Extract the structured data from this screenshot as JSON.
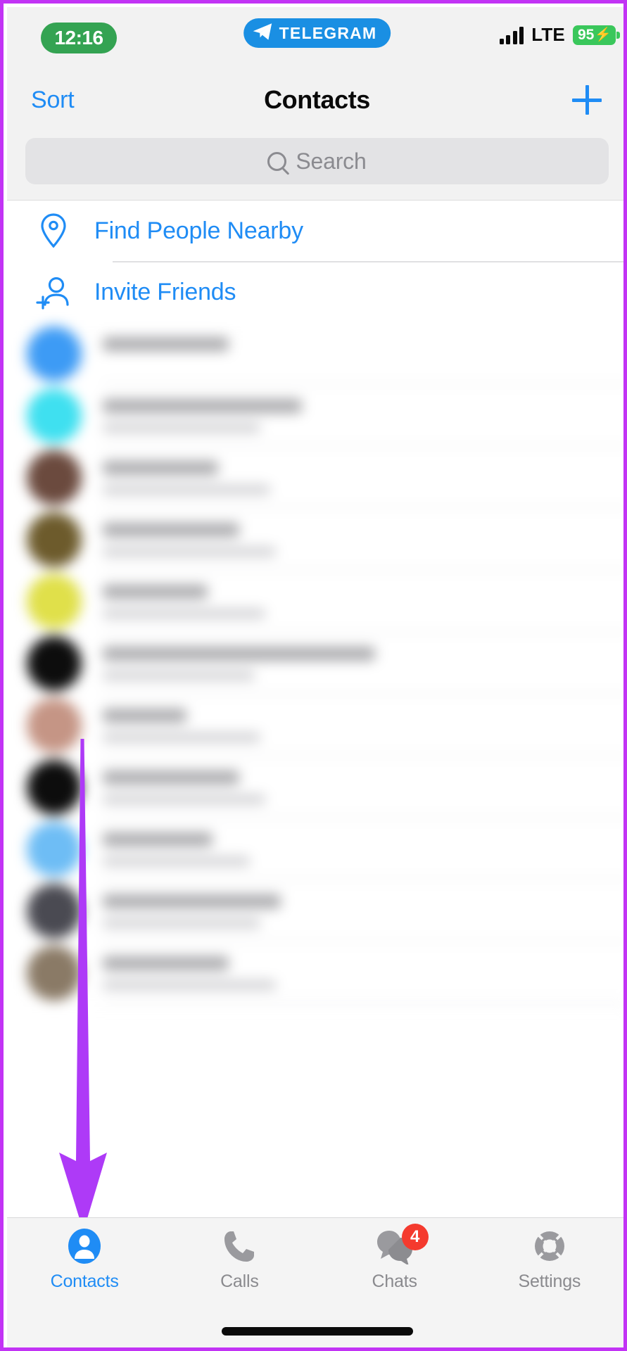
{
  "meta": {
    "app": "Telegram",
    "screen": "Contacts",
    "accent_blue": "#1f8cf5",
    "annotation_purple": "#c233f5",
    "frame_border_color": "#c233f5"
  },
  "status_bar": {
    "time": "12:16",
    "time_pill_color": "#34a352",
    "app_badge_label": "TELEGRAM",
    "app_badge_color": "#1a8fe3",
    "app_badge_icon": "telegram-plane-icon",
    "signal_icon": "cellular-signal-icon",
    "signal_bars": 4,
    "network": "LTE",
    "battery_percent": "95",
    "battery_charging_icon": "bolt-icon",
    "battery_color": "#3ac75b"
  },
  "nav_bar": {
    "left_action": "Sort",
    "title": "Contacts",
    "right_action_icon": "plus-icon"
  },
  "search": {
    "placeholder": "Search",
    "icon": "search-icon"
  },
  "actions": [
    {
      "label": "Find People Nearby",
      "icon": "location-pin-icon"
    },
    {
      "label": "Invite Friends",
      "icon": "person-add-icon"
    }
  ],
  "contact_list": {
    "blurred": true,
    "rows": [
      {
        "avatar_color": "#3d9bf5",
        "name_width": "24%",
        "sub_width": "0%"
      },
      {
        "avatar_color": "#3fe0f0",
        "name_width": "38%",
        "sub_width": "30%"
      },
      {
        "avatar_color": "#6b4a3e",
        "name_width": "22%",
        "sub_width": "32%"
      },
      {
        "avatar_color": "#6d5b2c",
        "name_width": "26%",
        "sub_width": "33%"
      },
      {
        "avatar_color": "#e0e04a",
        "name_width": "20%",
        "sub_width": "31%"
      },
      {
        "avatar_color": "#0d0d0d",
        "name_width": "52%",
        "sub_width": "29%"
      },
      {
        "avatar_color": "#c59585",
        "name_width": "16%",
        "sub_width": "30%"
      },
      {
        "avatar_color": "#0d0d0d",
        "name_width": "26%",
        "sub_width": "31%"
      },
      {
        "avatar_color": "#6ebdf5",
        "name_width": "21%",
        "sub_width": "28%"
      },
      {
        "avatar_color": "#4a4a52",
        "name_width": "34%",
        "sub_width": "30%"
      },
      {
        "avatar_color": "#8a7a66",
        "name_width": "24%",
        "sub_width": "33%"
      }
    ]
  },
  "annotation": {
    "type": "down-arrow",
    "color": "#ae3af7",
    "points_to": "Contacts"
  },
  "tab_bar": {
    "tabs": [
      {
        "label": "Contacts",
        "icon": "person-filled-icon",
        "active": true,
        "badge": ""
      },
      {
        "label": "Calls",
        "icon": "phone-icon",
        "active": false,
        "badge": ""
      },
      {
        "label": "Chats",
        "icon": "chat-bubbles-icon",
        "active": false,
        "badge": "4"
      },
      {
        "label": "Settings",
        "icon": "gear-icon",
        "active": false,
        "badge": ""
      }
    ]
  },
  "home_indicator": {
    "visible": true
  }
}
